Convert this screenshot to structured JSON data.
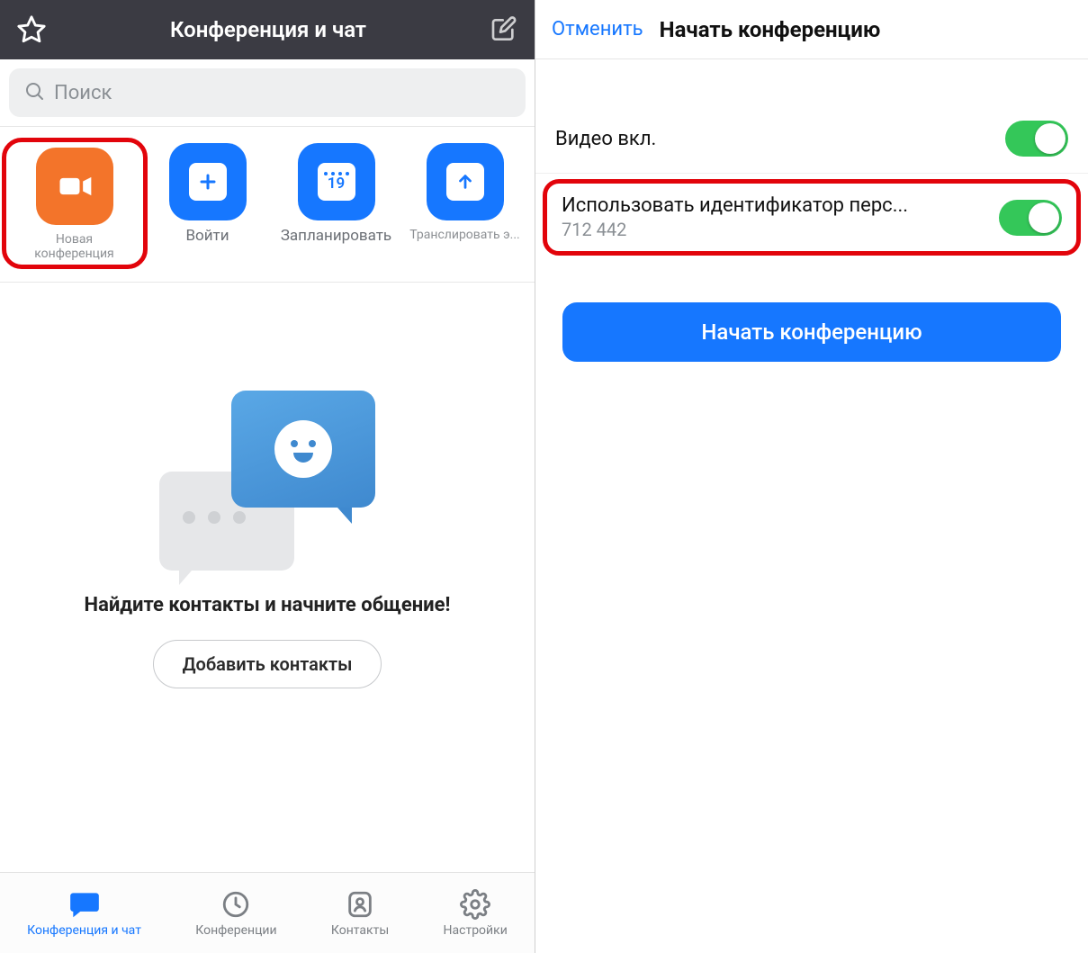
{
  "left": {
    "header_title": "Конференция и чат",
    "search_placeholder": "Поиск",
    "actions": {
      "new_meeting": {
        "line1": "Новая",
        "line2": "конференция"
      },
      "join": "Войти",
      "schedule": "Запланировать",
      "schedule_day": "19",
      "share": "Транслировать э..."
    },
    "empty": {
      "title": "Найдите контакты и начните общение!",
      "add_contacts": "Добавить контакты"
    },
    "tabs": {
      "chat": "Конференция и чат",
      "meetings": "Конференции",
      "contacts": "Контакты",
      "settings": "Настройки"
    }
  },
  "right": {
    "cancel": "Отменить",
    "title": "Начать конференцию",
    "video_label": "Видео вкл.",
    "video_on": true,
    "pmi_label": "Использовать идентификатор перс...",
    "pmi_value": "712 442",
    "pmi_on": true,
    "start_button": "Начать конференцию"
  },
  "colors": {
    "accent_blue": "#1677ff",
    "accent_orange": "#f3742a",
    "toggle_green": "#34c759",
    "highlight_red": "#e2040b"
  }
}
